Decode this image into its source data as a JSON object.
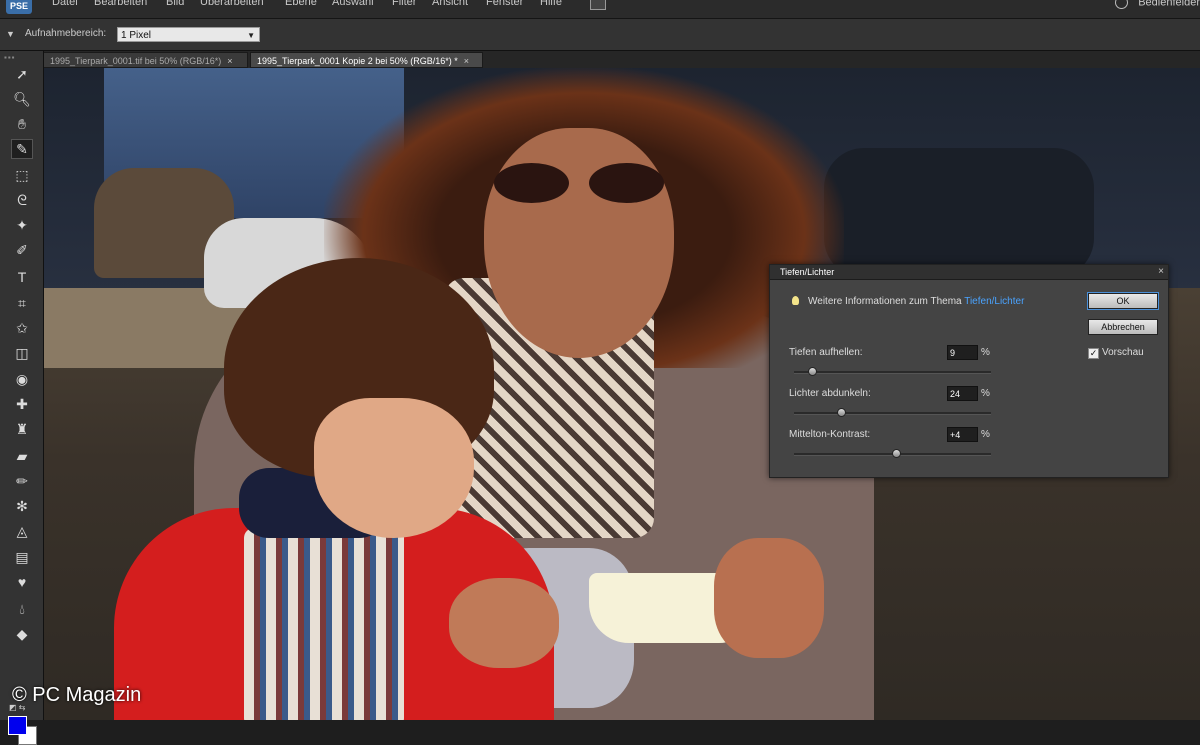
{
  "menubar": {
    "logo": "PSE",
    "items": [
      "Datei",
      "Bearbeiten",
      "Bild",
      "Überarbeiten",
      "Ebene",
      "Auswahl",
      "Filter",
      "Ansicht",
      "Fenster",
      "Hilfe"
    ],
    "right_label": "Bedienfelder"
  },
  "options": {
    "label": "Aufnahmebereich:",
    "sample_value": "1 Pixel"
  },
  "tabs": [
    {
      "label": "1995_Tierpark_0001.tif bei 50% (RGB/16*)",
      "active": false
    },
    {
      "label": "1995_Tierpark_0001 Kopie 2 bei 50% (RGB/16*) *",
      "active": true
    }
  ],
  "tools": [
    "move-icon",
    "zoom-icon",
    "hand-icon",
    "eyedropper-icon",
    "marquee-icon",
    "lasso-icon",
    "magic-wand-icon",
    "quick-selection-icon",
    "type-icon",
    "crop-icon",
    "recompose-icon",
    "cookie-cutter-icon",
    "red-eye-icon",
    "spot-healing-icon",
    "clone-stamp-icon",
    "eraser-icon",
    "brush-icon",
    "smart-brush-icon",
    "paint-bucket-icon",
    "gradient-icon",
    "shape-icon",
    "blur-icon",
    "sponge-icon"
  ],
  "watermark": "© PC Magazin",
  "dialog": {
    "title": "Tiefen/Lichter",
    "close": "×",
    "info_text": "Weitere Informationen zum Thema",
    "info_link": "Tiefen/Lichter",
    "ok_label": "OK",
    "cancel_label": "Abbrechen",
    "preview_label": "Vorschau",
    "preview_checked": true,
    "sliders": [
      {
        "label": "Tiefen aufhellen:",
        "value": "9",
        "unit": "%",
        "percent": 9
      },
      {
        "label": "Lichter abdunkeln:",
        "value": "24",
        "unit": "%",
        "percent": 24
      },
      {
        "label": "Mittelton-Kontrast:",
        "value": "+4",
        "unit": "%",
        "percent": 52
      }
    ]
  },
  "colors": {
    "foreground": "#0000ee",
    "background": "#ffffff",
    "link": "#4aa3ff"
  }
}
